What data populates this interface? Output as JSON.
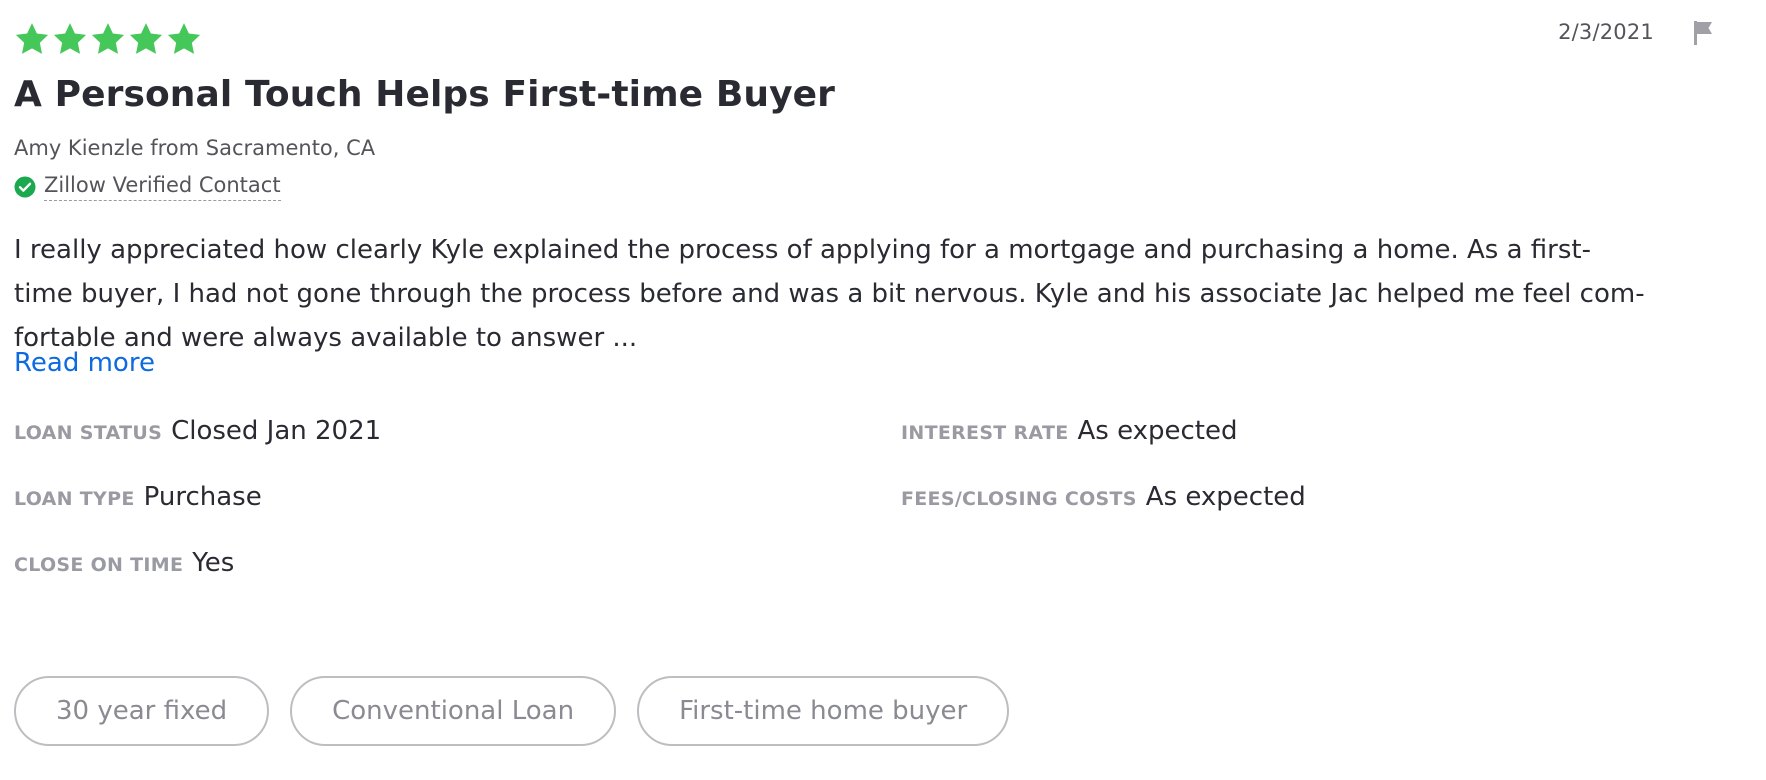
{
  "review": {
    "rating": 5,
    "rating_max": 5,
    "star_color": "#46c75a",
    "date": "2/3/2021",
    "flag_icon": "flag-icon",
    "title": "A Personal Touch Helps First-time Buyer",
    "reviewer": "Amy Kienzle from Sacramento, CA",
    "verified": {
      "icon": "check-circle-icon",
      "color": "#1aa94f",
      "label": "Zillow Verified Contact"
    },
    "body_lines": [
      "I really appreciated how clearly Kyle explained the process of applying for a mortgage and purchasing a home. As a first-",
      "time buyer, I had not gone through the process before and was a bit nervous. Kyle and his associate Jac helped me feel com-",
      "fortable and were always available to answer ..."
    ],
    "read_more": "Read more",
    "read_more_color": "#0d6ae0"
  },
  "details": {
    "loan_status": {
      "label": "LOAN STATUS",
      "value": "Closed Jan 2021"
    },
    "interest_rate": {
      "label": "INTEREST RATE",
      "value": "As expected"
    },
    "loan_type": {
      "label": "LOAN TYPE",
      "value": "Purchase"
    },
    "fees_closing_costs": {
      "label": "FEES/CLOSING COSTS",
      "value": "As expected"
    },
    "close_on_time": {
      "label": "CLOSE ON TIME",
      "value": "Yes"
    }
  },
  "tags": [
    "30 year fixed",
    "Conventional Loan",
    "First-time home buyer"
  ]
}
